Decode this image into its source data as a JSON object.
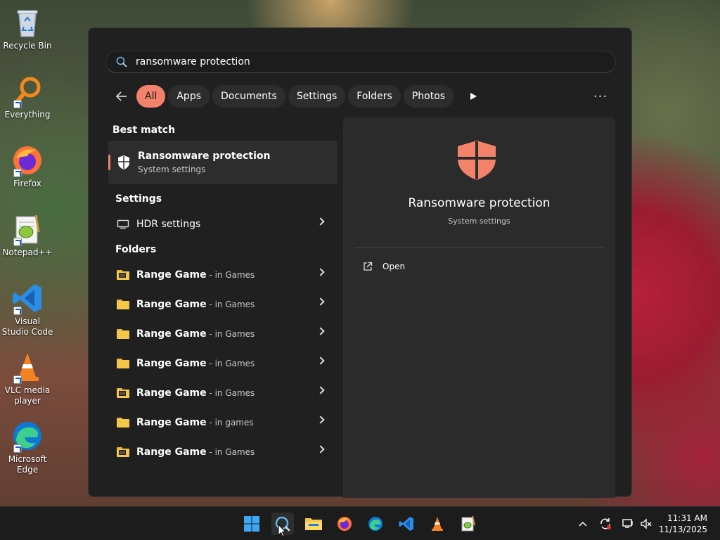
{
  "desktop": {
    "icons": [
      {
        "label": "Recycle Bin"
      },
      {
        "label": "Everything"
      },
      {
        "label": "Firefox"
      },
      {
        "label": "Notepad++"
      },
      {
        "label": "Visual Studio Code"
      },
      {
        "label": "VLC media player"
      },
      {
        "label": "Microsoft Edge"
      }
    ]
  },
  "search": {
    "query": "ransomware protection",
    "filters": [
      "All",
      "Apps",
      "Documents",
      "Settings",
      "Folders",
      "Photos"
    ],
    "active_filter": "All",
    "more_label": "···"
  },
  "results": {
    "best_match_title": "Best match",
    "best_match": {
      "title": "Ransomware protection",
      "subtitle": "System settings"
    },
    "settings_title": "Settings",
    "settings_items": [
      {
        "title": "HDR settings"
      }
    ],
    "folders_title": "Folders",
    "folder_items": [
      {
        "title": "Range Game",
        "location": " - in Games"
      },
      {
        "title": "Range Game",
        "location": " - in Games"
      },
      {
        "title": "Range Game",
        "location": " - in Games"
      },
      {
        "title": "Range Game",
        "location": " - in Games"
      },
      {
        "title": "Range Game",
        "location": " - in Games"
      },
      {
        "title": "Range Game",
        "location": " - in games"
      },
      {
        "title": "Range Game",
        "location": " - in Games"
      }
    ]
  },
  "preview": {
    "title": "Ransomware protection",
    "subtitle": "System settings",
    "open_label": "Open",
    "accent_color": "#f2826a"
  },
  "taskbar": {
    "apps": [
      "start-icon",
      "search-icon",
      "file-explorer-icon",
      "firefox-icon",
      "edge-icon",
      "vscode-icon",
      "vlc-icon",
      "notepad-plus-plus-icon"
    ],
    "time": "11:31 AM",
    "date": "11/13/2025"
  }
}
